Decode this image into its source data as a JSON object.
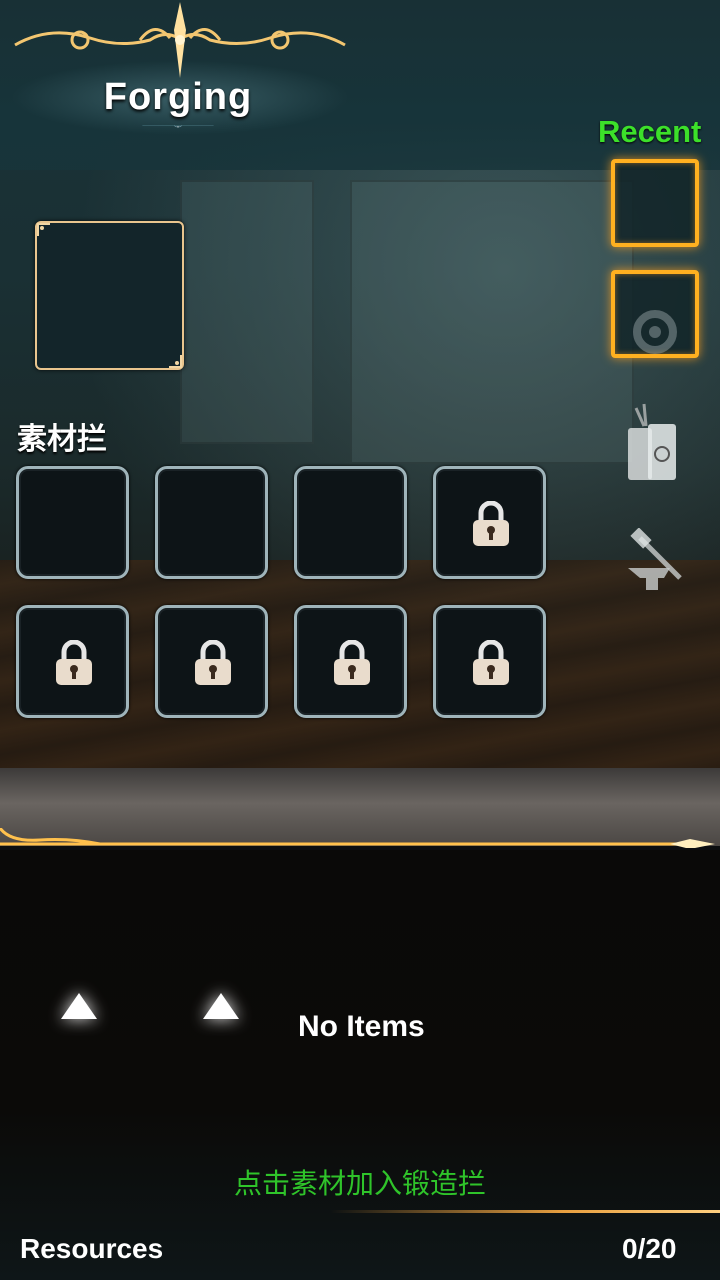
{
  "header": {
    "title": "Forging"
  },
  "recent": {
    "label": "Recent"
  },
  "materials": {
    "label": "素材拦",
    "slots": [
      {
        "locked": false
      },
      {
        "locked": false
      },
      {
        "locked": false
      },
      {
        "locked": true
      },
      {
        "locked": true
      },
      {
        "locked": true
      },
      {
        "locked": true
      },
      {
        "locked": true
      }
    ]
  },
  "inventory": {
    "empty_text": "No Items",
    "hint": "点击素材加入锻造拦"
  },
  "footer": {
    "resources_label": "Resources",
    "resources_count": "0/20"
  },
  "colors": {
    "accent_green": "#3ce02a",
    "slot_gold": "#ffb020",
    "hint_green": "#2fc42a"
  }
}
